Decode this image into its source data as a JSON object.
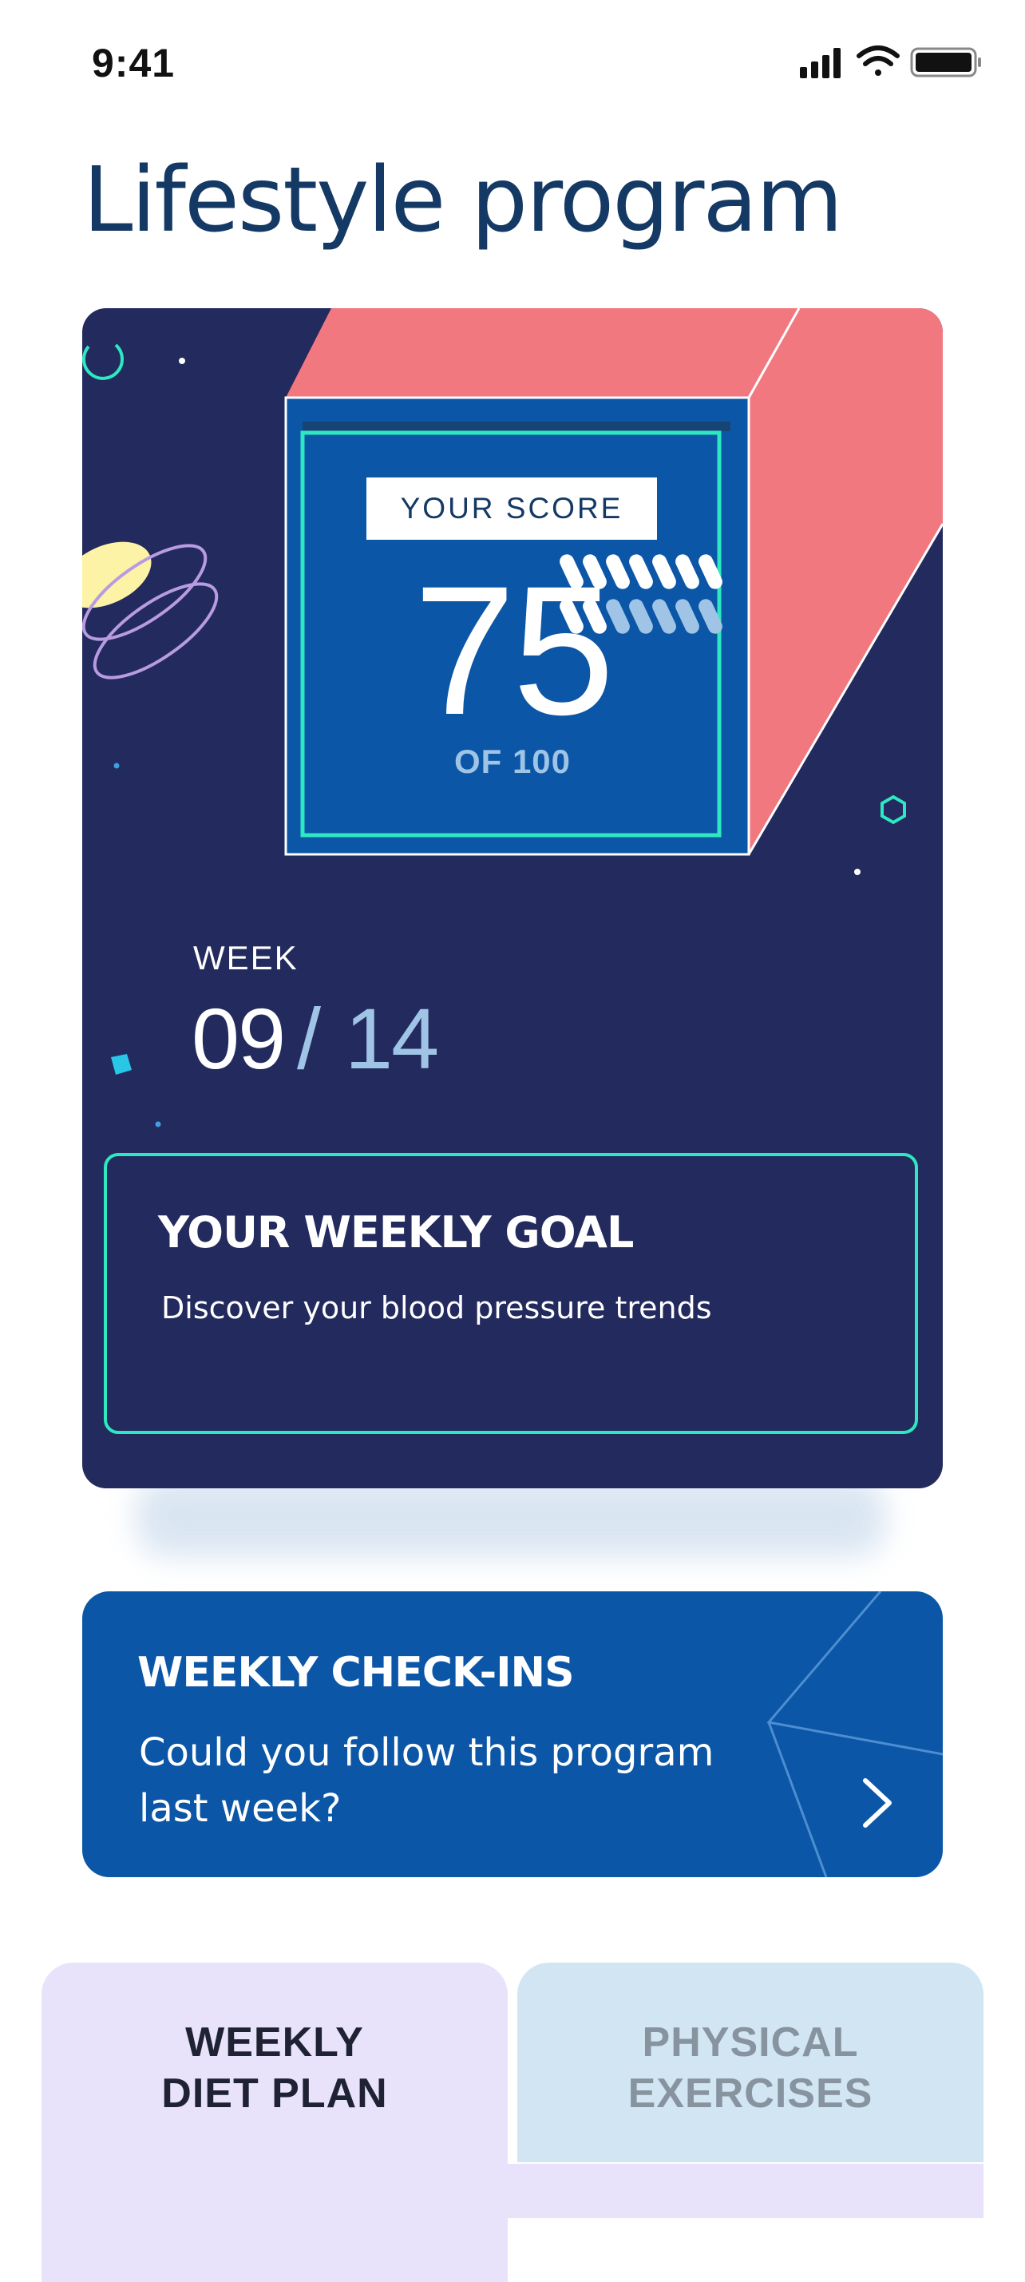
{
  "status_bar": {
    "time": "9:41"
  },
  "page": {
    "title": "Lifestyle program"
  },
  "score_card": {
    "score_tag": "YOUR SCORE",
    "score_value": "75",
    "score_max_label": "OF 100",
    "week_label": "WEEK",
    "week_current": "09",
    "week_separator": "/",
    "week_total": "14",
    "weeks_completed": 9,
    "weeks_total": 14,
    "goal_title": "YOUR WEEKLY GOAL",
    "goal_text": "Discover your blood pressure trends"
  },
  "checkins": {
    "title": "WEEKLY CHECK-INS",
    "text": "Could you follow this program last week?"
  },
  "tabs": [
    {
      "label_line1": "WEEKLY",
      "label_line2": "DIET PLAN",
      "selected": true
    },
    {
      "label_line1": "PHYSICAL",
      "label_line2": "EXERCISES",
      "selected": false
    }
  ],
  "colors": {
    "title": "#143964",
    "card_bg": "#232a5e",
    "accent_coral": "#f27880",
    "score_box": "#0b56a6",
    "accent_teal": "#2ee8c2",
    "light_blue": "#9fc4e6"
  }
}
